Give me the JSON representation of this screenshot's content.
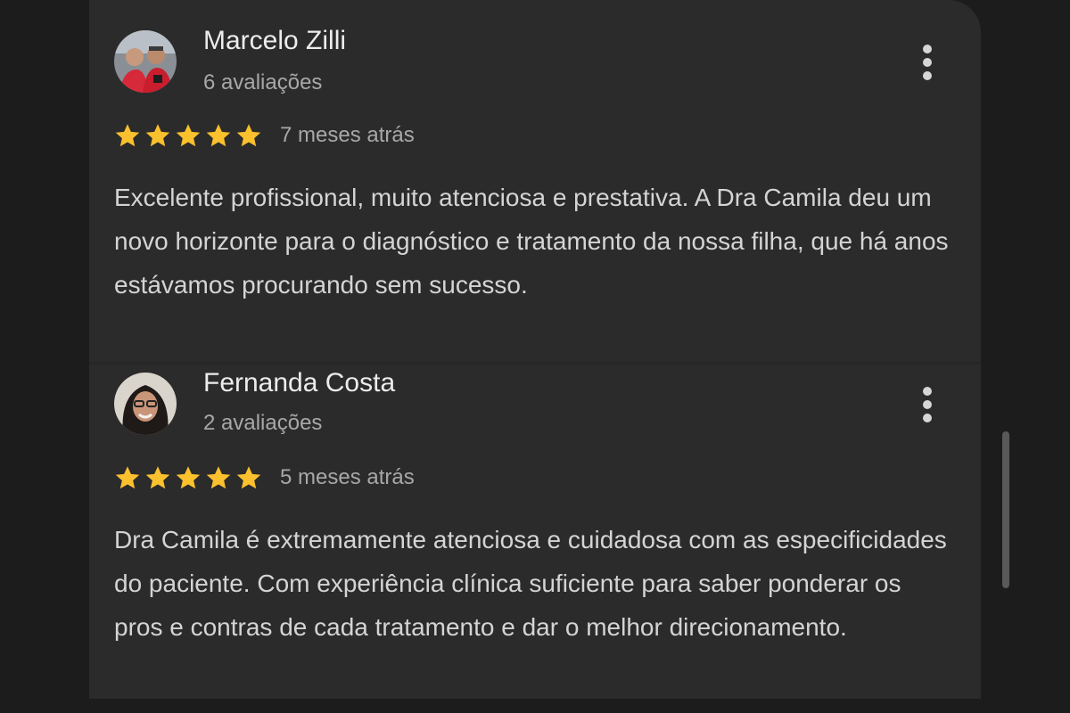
{
  "reviews": [
    {
      "author": "Marcelo Zilli",
      "review_count": "6 avaliações",
      "rating": 5,
      "max_rating": 5,
      "time_ago": "7 meses atrás",
      "text": "Excelente profissional, muito atenciosa e prestativa. A Dra Camila deu um novo horizonte para o diagnóstico e tratamento da nossa filha, que há anos estávamos procurando sem sucesso.",
      "menu_icon": "more-vertical-icon"
    },
    {
      "author": "Fernanda Costa",
      "review_count": "2 avaliações",
      "rating": 5,
      "max_rating": 5,
      "time_ago": "5 meses atrás",
      "text": "Dra Camila é extremamente atenciosa e cuidadosa com as especificidades do paciente. Com experiência clínica suficiente para saber ponderar os pros e contras de cada tratamento e dar o melhor direcionamento.",
      "menu_icon": "more-vertical-icon"
    }
  ],
  "colors": {
    "background": "#1c1c1c",
    "card": "#2b2b2b",
    "star": "#fbc02d",
    "primary_text": "#ececec",
    "secondary_text": "#a8a8a8"
  }
}
